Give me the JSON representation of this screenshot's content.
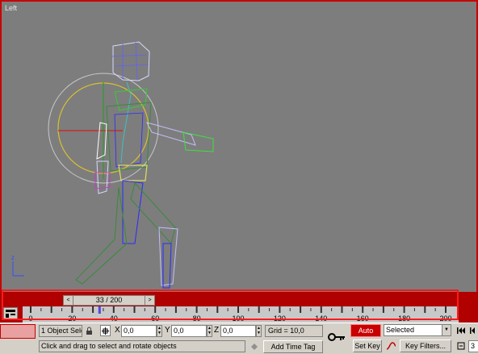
{
  "viewport": {
    "label": "Left",
    "background": "#7d7d7d",
    "border_color": "#c80000"
  },
  "timeline": {
    "slider_label": "33 / 200",
    "prev_arrow": "<",
    "next_arrow": ">",
    "ticks": [
      "0",
      "20",
      "40",
      "60",
      "80",
      "100",
      "120",
      "140",
      "160",
      "180",
      "200"
    ],
    "current_frame": 33,
    "total_frames": 200
  },
  "status": {
    "selection": "1 Object Sele",
    "x_label": "X",
    "x_value": "0,0",
    "y_label": "Y",
    "y_value": "0,0",
    "z_label": "Z",
    "z_value": "0,0",
    "grid": "Grid = 10,0",
    "prompt": "Click and drag to select and rotate objects",
    "add_time_tag": "Add Time Tag"
  },
  "animation": {
    "auto_key": "Auto Key",
    "set_key": "Set Key",
    "selected": "Selected",
    "key_filters": "Key Filters...",
    "frame_value": "3"
  },
  "colors": {
    "accent": "#c80000",
    "panel": "#d4d0c8"
  }
}
